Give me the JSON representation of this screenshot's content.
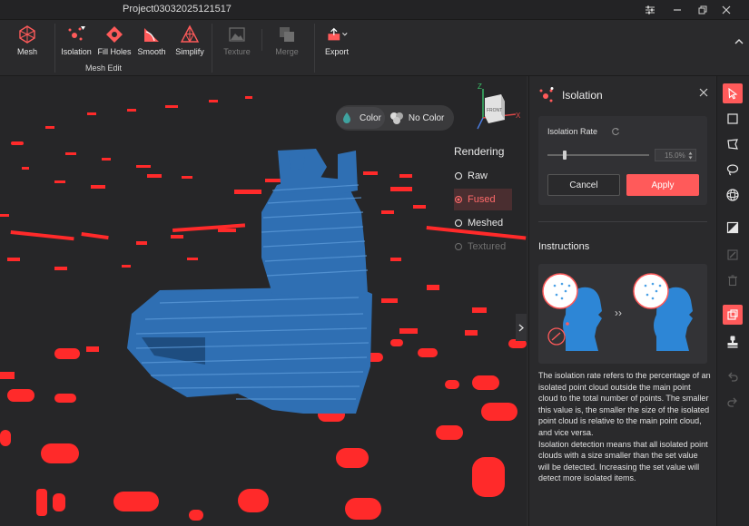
{
  "window": {
    "title": "Project03032025121517"
  },
  "ribbon": {
    "buttons": {
      "mesh": "Mesh",
      "isolation": "Isolation",
      "fill_holes": "Fill Holes",
      "smooth": "Smooth",
      "simplify": "Simplify",
      "texture": "Texture",
      "merge": "Merge",
      "export": "Export"
    },
    "group_label": "Mesh Edit"
  },
  "viewport": {
    "color_toggle": {
      "color": "Color",
      "no_color": "No Color"
    },
    "gizmo": {
      "front_label": "FRONT",
      "z": "Z",
      "x": "X"
    },
    "rendering": {
      "title": "Rendering",
      "options": [
        "Raw",
        "Fused",
        "Meshed",
        "Textured"
      ],
      "selected": "Fused"
    }
  },
  "panel": {
    "title": "Isolation",
    "isolation_rate_label": "Isolation Rate",
    "isolation_rate_value": "15.0%",
    "isolation_rate_level": 15,
    "cancel": "Cancel",
    "apply": "Apply",
    "instructions_title": "Instructions",
    "instructions_text": "The isolation rate refers to the percentage of an isolated point cloud outside the main point cloud to the total number of points. The smaller this value is, the smaller the size of the isolated point cloud is relative to the main point cloud, and vice versa.\nIsolation detection means that all isolated point clouds with a size smaller than the set value will be detected. Increasing the set value will detect more isolated items."
  },
  "colors": {
    "accent": "#ff5a5a",
    "mesh_blue": "#2f6fb3",
    "isolated_red": "#ff2a2a",
    "background": "#262628"
  }
}
